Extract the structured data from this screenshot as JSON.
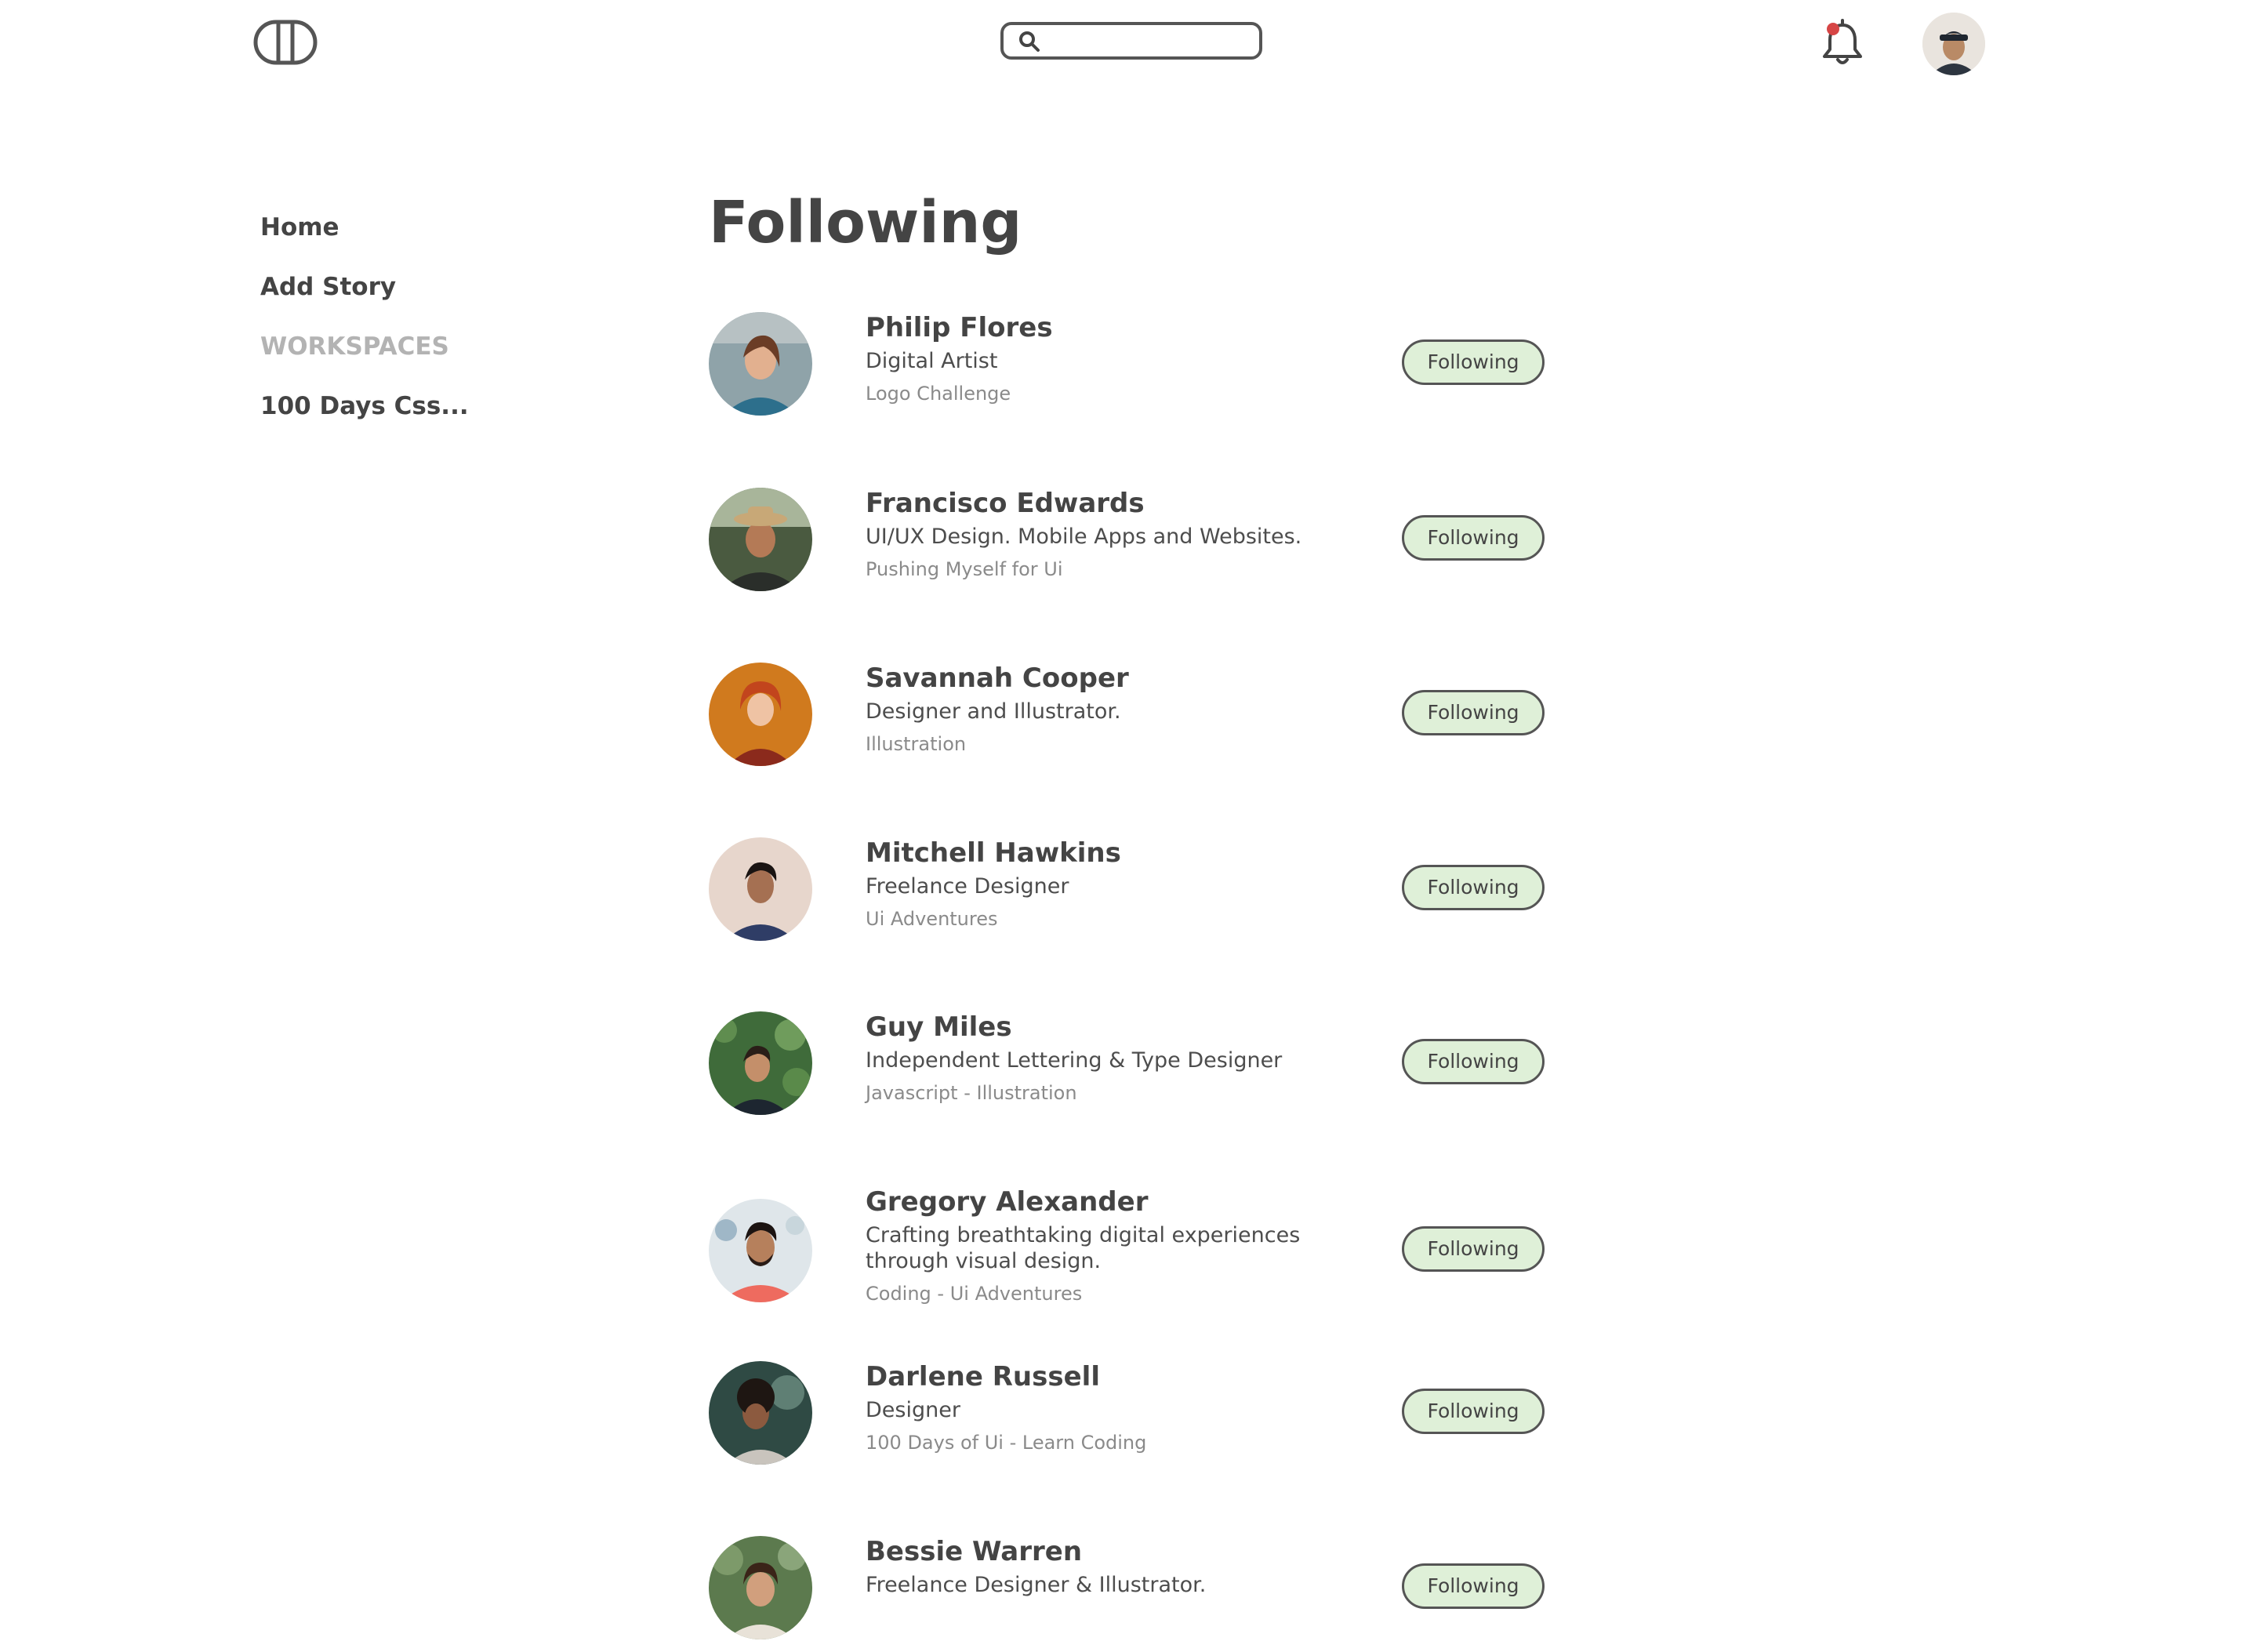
{
  "header": {
    "search": {
      "placeholder": "",
      "value": ""
    }
  },
  "sidebar": {
    "items": [
      {
        "label": "Home"
      },
      {
        "label": "Add Story"
      },
      {
        "label": "WORKSPACES"
      },
      {
        "label": "100 Days Css..."
      }
    ]
  },
  "main": {
    "title": "Following",
    "users": [
      {
        "name": "Philip Flores",
        "bio": "Digital Artist",
        "tags": "Logo Challenge",
        "button": "Following"
      },
      {
        "name": "Francisco Edwards",
        "bio": "UI/UX Design. Mobile Apps and Websites.",
        "tags": "Pushing Myself for Ui",
        "button": "Following"
      },
      {
        "name": "Savannah Cooper",
        "bio": "Designer and Illustrator.",
        "tags": "Illustration",
        "button": "Following"
      },
      {
        "name": "Mitchell Hawkins",
        "bio": "Freelance Designer",
        "tags": "Ui Adventures",
        "button": "Following"
      },
      {
        "name": "Guy Miles",
        "bio": "Independent Lettering & Type Designer",
        "tags": "Javascript - Illustration",
        "button": "Following"
      },
      {
        "name": "Gregory Alexander",
        "bio": "Crafting breathtaking digital experiences through visual design.",
        "tags": "Coding - Ui Adventures",
        "button": "Following"
      },
      {
        "name": "Darlene Russell",
        "bio": "Designer",
        "tags": "100 Days of Ui - Learn Coding",
        "button": "Following"
      },
      {
        "name": "Bessie Warren",
        "bio": "Freelance Designer & Illustrator.",
        "tags": "",
        "button": "Following"
      }
    ]
  },
  "colors": {
    "text": "#444444",
    "muted": "#b3b3b3",
    "button_bg": "#dff0d8",
    "button_border": "#555555",
    "notification_dot": "#d64545"
  },
  "icons": {
    "logo": "split-circle-logo-icon",
    "search": "search-icon",
    "notifications": "bell-icon"
  }
}
